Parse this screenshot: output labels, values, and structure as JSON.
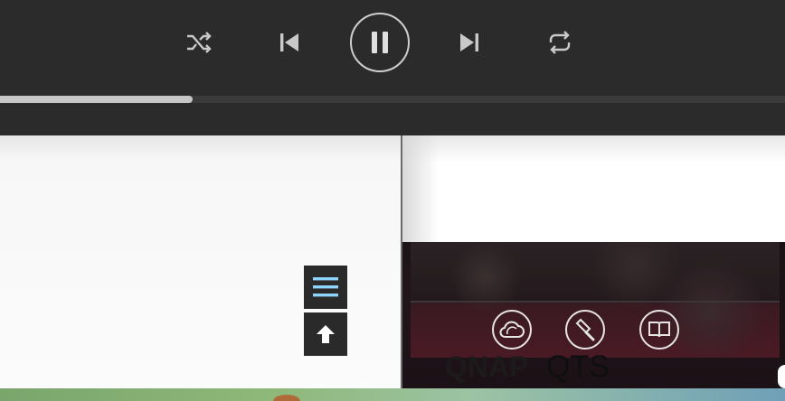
{
  "player": {
    "controls": {
      "shuffle_icon": "shuffle-icon",
      "prev_icon": "skip-previous-icon",
      "play_state_icon": "pause-icon",
      "next_icon": "skip-next-icon",
      "repeat_icon": "repeat-icon"
    },
    "progress_fraction": 0.245
  },
  "hero": {
    "brand": "QNAP",
    "product": "QTS",
    "tool_icons": [
      "cloud-icon",
      "hammer-icon",
      "book-icon"
    ]
  },
  "floating_buttons": {
    "menu_icon": "hamburger-menu-icon",
    "up_icon": "arrow-up-icon"
  },
  "colors": {
    "player_bg": "#2b2b2b",
    "progress_fill": "#c7c7c7",
    "menu_icon": "#8fd3ff"
  }
}
